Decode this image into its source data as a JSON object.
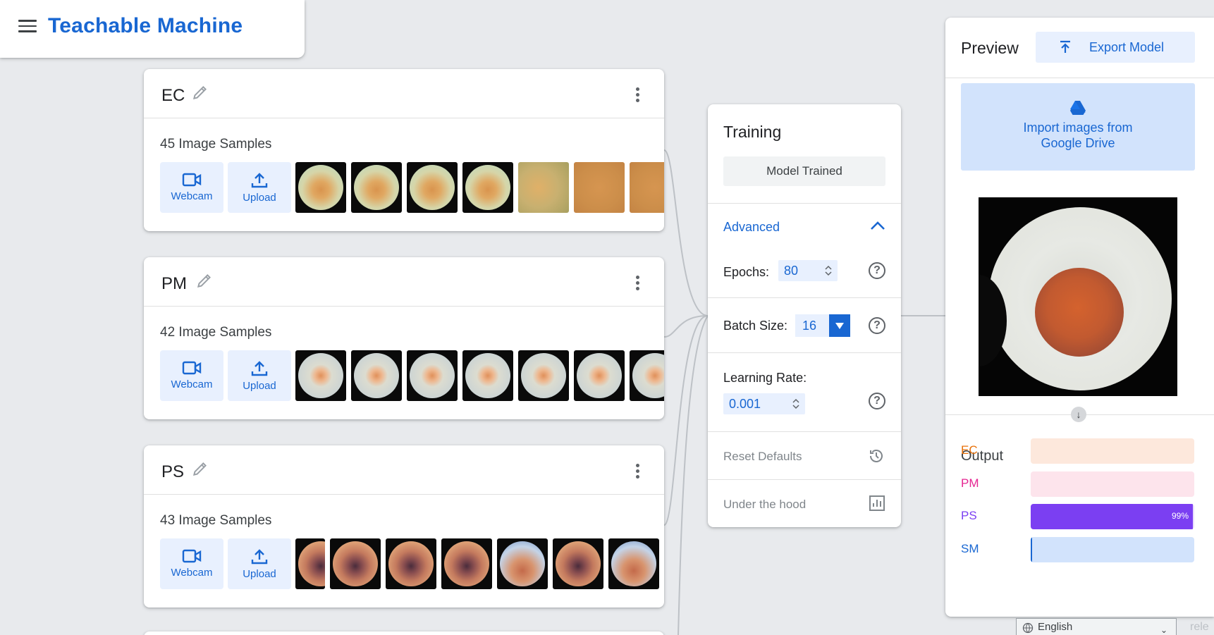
{
  "app": {
    "title": "Teachable Machine"
  },
  "classes": [
    {
      "name": "EC",
      "samples": "45 Image Samples"
    },
    {
      "name": "PM",
      "samples": "42 Image Samples"
    },
    {
      "name": "PS",
      "samples": "43 Image Samples"
    }
  ],
  "sample_buttons": {
    "webcam": "Webcam",
    "upload": "Upload"
  },
  "training": {
    "title": "Training",
    "status": "Model Trained",
    "advanced": "Advanced",
    "epochs_label": "Epochs:",
    "epochs_value": "80",
    "batch_label": "Batch Size:",
    "batch_value": "16",
    "lr_label": "Learning Rate:",
    "lr_value": "0.001",
    "reset": "Reset Defaults",
    "hood": "Under the hood",
    "help_glyph": "?"
  },
  "preview": {
    "title": "Preview",
    "export": "Export Model",
    "drive_line1": "Import images from",
    "drive_line2": "Google Drive",
    "output_title": "Output",
    "outputs": [
      {
        "label": "EC",
        "color": "#e8710a",
        "bg": "#fde8dc",
        "value": 0.0,
        "pct": ""
      },
      {
        "label": "PM",
        "color": "#e52592",
        "bg": "#fde4ec",
        "value": 0.0,
        "pct": ""
      },
      {
        "label": "PS",
        "color": "#7b3ff2",
        "bg": "#e9defc",
        "value": 0.99,
        "pct": "99%"
      },
      {
        "label": "SM",
        "color": "#1967d2",
        "bg": "#d2e3fc",
        "value": 0.005,
        "pct": ""
      }
    ]
  },
  "footer": {
    "language": "English",
    "release": "rele"
  },
  "colors": {
    "accent": "#1967d2",
    "background": "#e8eaed"
  }
}
